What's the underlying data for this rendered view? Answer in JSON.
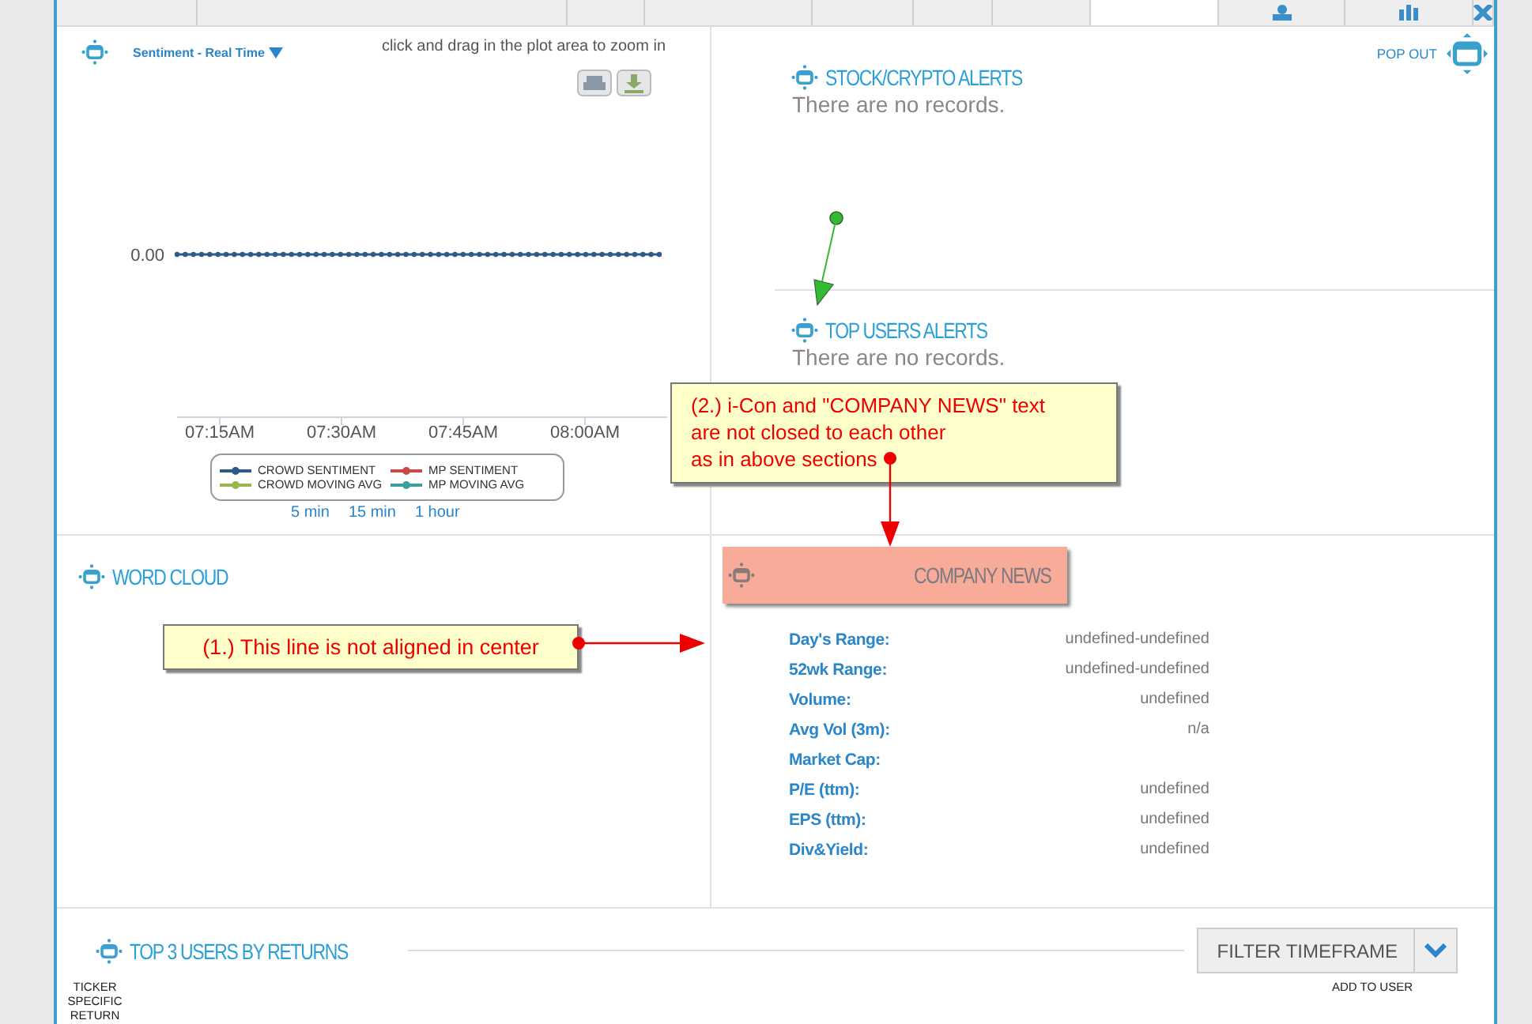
{
  "top_strip": [
    {
      "selected": false,
      "kind": "plain"
    },
    {
      "selected": false,
      "kind": "plain"
    },
    {
      "selected": false,
      "kind": "plain"
    },
    {
      "selected": false,
      "kind": "plain"
    },
    {
      "selected": false,
      "kind": "plain"
    },
    {
      "selected": false,
      "kind": "plain"
    },
    {
      "selected": false,
      "kind": "plain"
    },
    {
      "selected": true,
      "kind": "plain"
    },
    {
      "selected": false,
      "kind": "person"
    },
    {
      "selected": false,
      "kind": "bars"
    },
    {
      "selected": false,
      "kind": "close"
    }
  ],
  "sentiment": {
    "title": "Sentiment - Real Time",
    "hint": "click and drag in the plot area to zoom in",
    "value_label": "0.00",
    "time_labels": [
      "07:15AM",
      "07:30AM",
      "07:45AM",
      "08:00AM"
    ],
    "legend": [
      {
        "name": "CROWD SENTIMENT",
        "color": "#2e5a88"
      },
      {
        "name": "MP SENTIMENT",
        "color": "#c84a4a"
      },
      {
        "name": "CROWD MOVING AVG",
        "color": "#9ab84a"
      },
      {
        "name": "MP MOVING AVG",
        "color": "#3aa0a0"
      }
    ],
    "ranges": [
      {
        "label": "5 min"
      },
      {
        "label": "15 min"
      },
      {
        "label": "1 hour"
      }
    ]
  },
  "pop_out": "POP OUT",
  "stock_alerts": {
    "title": "STOCK/CRYPTO ALERTS",
    "empty": "There are no records."
  },
  "top_users_alerts": {
    "title": "TOP USERS ALERTS",
    "empty": "There are no records."
  },
  "word_cloud": {
    "title": "WORD CLOUD"
  },
  "company_news": {
    "title": "COMPANY NEWS",
    "rows": [
      {
        "label": "Day's Range:",
        "value": "undefined-undefined"
      },
      {
        "label": "52wk Range:",
        "value": "undefined-undefined"
      },
      {
        "label": "Volume:",
        "value": "undefined"
      },
      {
        "label": "Avg Vol (3m):",
        "value": "n/a"
      },
      {
        "label": "Market Cap:"
      },
      {
        "label": "P/E (ttm):",
        "value": "undefined"
      },
      {
        "label": "EPS (ttm):",
        "value": "undefined"
      },
      {
        "label": "Div&Yield:",
        "value": "undefined"
      }
    ]
  },
  "top_users": {
    "title": "TOP 3 USERS BY RETURNS",
    "filter": "FILTER TIMEFRAME",
    "columns": [
      {
        "label": "TICKER SPECIFIC RETURN"
      },
      {
        "label": "ADD TO USER"
      }
    ]
  },
  "annotations": [
    {
      "text": "(1.) This line is not aligned in center",
      "kind": "left"
    },
    {
      "text": "(2.) i-Con and \"COMPANY NEWS\" text\nare not closed to each other\nas in above sections",
      "kind": "down"
    }
  ]
}
